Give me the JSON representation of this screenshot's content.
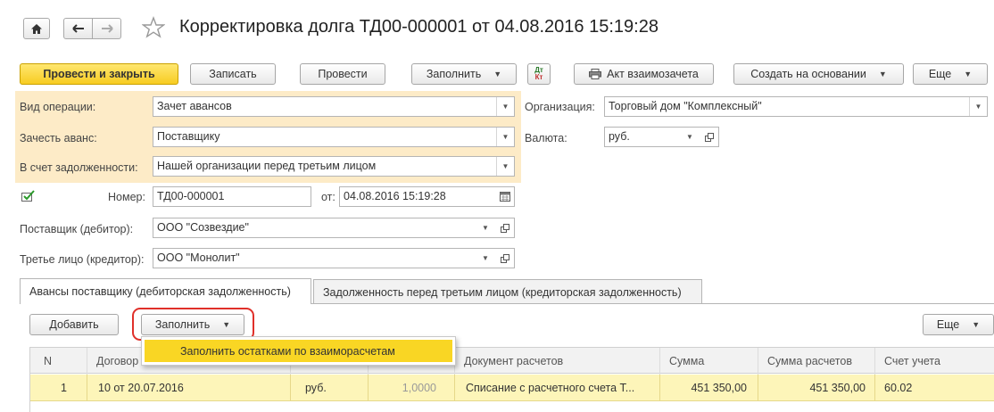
{
  "header": {
    "title": "Корректировка долга ТД00-000001 от 04.08.2016 15:19:28"
  },
  "toolbar": {
    "post_close": "Провести и закрыть",
    "save": "Записать",
    "post": "Провести",
    "fill": "Заполнить",
    "dtkt_top": "Дт",
    "dtkt_bottom": "Кт",
    "act": "Акт взаимозачета",
    "create_based": "Создать на основании",
    "more": "Еще"
  },
  "form": {
    "operation_label": "Вид операции:",
    "operation_value": "Зачет авансов",
    "offset_label": "Зачесть аванс:",
    "offset_value": "Поставщику",
    "debt_label": "В счет задолженности:",
    "debt_value": "Нашей организации перед третьим лицом",
    "org_label": "Организация:",
    "org_value": "Торговый дом \"Комплексный\"",
    "currency_label": "Валюта:",
    "currency_value": "руб.",
    "number_label": "Номер:",
    "number_value": "ТД00-000001",
    "date_label": "от:",
    "date_value": "04.08.2016 15:19:28",
    "supplier_label": "Поставщик (дебитор):",
    "supplier_value": "ООО \"Созвездие\"",
    "third_label": "Третье лицо (кредитор):",
    "third_value": "ООО \"Монолит\""
  },
  "tabs": [
    {
      "label": "Авансы поставщику (дебиторская задолженность)"
    },
    {
      "label": "Задолженность перед третьим лицом (кредиторская задолженность)"
    }
  ],
  "table_toolbar": {
    "add": "Добавить",
    "fill": "Заполнить",
    "more": "Еще",
    "menu_item": "Заполнить остатками по взаиморасчетам"
  },
  "table": {
    "columns": [
      "N",
      "Договор",
      "",
      "",
      "Документ расчетов",
      "Сумма",
      "Сумма расчетов",
      "Счет учета"
    ],
    "rows": [
      {
        "n": "1",
        "contract": "10 от 20.07.2016",
        "currency": "руб.",
        "rate": "1,0000",
        "document": "Списание с расчетного счета Т...",
        "amount": "451 350,00",
        "settlement_amount": "451 350,00",
        "account": "60.02"
      }
    ]
  },
  "colors": {
    "accent_yellow": "#f7cc22",
    "highlight_panel": "#fdebc7",
    "selected_row": "#fdf5b9",
    "callout_red": "#e0302a"
  }
}
